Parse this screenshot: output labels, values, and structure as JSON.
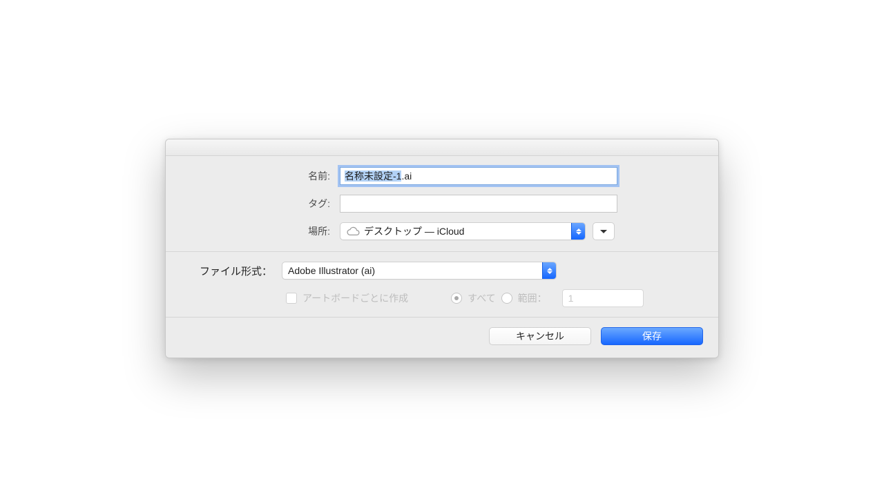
{
  "labels": {
    "name": "名前:",
    "tags": "タグ:",
    "location": "場所:",
    "format": "ファイル形式：",
    "perArtboard": "アートボードごとに作成",
    "all": "すべて",
    "range": "範囲："
  },
  "fields": {
    "name_selected": "名称未設定-1",
    "name_ext": ".ai",
    "tags_value": "",
    "location_value": "デスクトップ — iCloud",
    "format_value": "Adobe Illustrator (ai)",
    "range_value": "1"
  },
  "buttons": {
    "cancel": "キャンセル",
    "save": "保存"
  },
  "icons": {
    "cloud": "cloud-icon",
    "expand": "chevron-down-icon",
    "stepper": "up-down-icon"
  }
}
